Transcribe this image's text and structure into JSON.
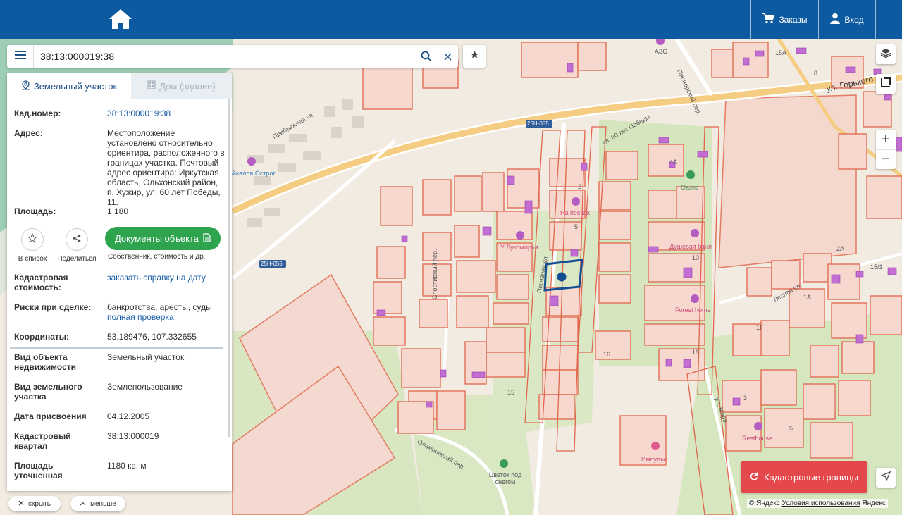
{
  "topbar": {
    "orders_label": "Заказы",
    "login_label": "Вход"
  },
  "search": {
    "value": "38:13:000019:38"
  },
  "tabs": [
    {
      "label": "Земельный участок",
      "active": true
    },
    {
      "label": "Дом (здание)",
      "active": false
    }
  ],
  "info": {
    "cad_number": {
      "label": "Кад.номер:",
      "value": "38:13:000019:38"
    },
    "address": {
      "label": "Адрес:",
      "value": "Местоположение установлено относительно ориентира, расположенного в границах участка. Почтовый адрес ориентира: Иркутская область, Ольхонский район, п. Хужир, ул. 60 лет Победы, 11."
    },
    "area": {
      "label": "Площадь:",
      "value": "1 180"
    },
    "cad_value": {
      "label": "Кадастровая стоимость:",
      "link": "заказать справку на дату"
    },
    "risks": {
      "label": "Риски при сделке:",
      "value": "банкротства, аресты, суды",
      "link": "полная проверка"
    },
    "coords": {
      "label": "Координаты:",
      "value": "53.189476, 107.332655"
    },
    "object_type": {
      "label": "Вид объекта недвижимости",
      "value": "Земельный участок"
    },
    "land_type": {
      "label": "Вид земельного участка",
      "value": "Землепользование"
    },
    "assigned_date": {
      "label": "Дата присвоения",
      "value": "04.12.2005"
    },
    "quarter": {
      "label": "Кадастровый квартал",
      "value": "38:13:000019"
    },
    "refined_area": {
      "label": "Площадь уточненная",
      "value": "1180 кв. м"
    }
  },
  "actions": {
    "favorite_label": "В список",
    "share_label": "Поделиться",
    "docs_label": "Документы объекта",
    "docs_sub": "Собственник, стоимость и др."
  },
  "bottom": {
    "hide_label": "скрыть",
    "less_label": "меньше"
  },
  "map": {
    "cadastral_button": "Кадастровые границы",
    "copyright_prefix": "© Яндекс",
    "copyright_link": "Условия использования",
    "copyright_suffix": "Яндекс",
    "labels": {
      "gorkogo": "ул. Горького",
      "pionerskiy": "Пионерский пер.",
      "pobedy": "ул. 60 лет Победы",
      "pribrezhnaya": "Прибрежная ул.",
      "road1": "25Н-055",
      "road2": "25Н-055",
      "sportivnyy": "Спортивный пер.",
      "peschanaya": "Песчаная ул.",
      "olimpiyskiy": "Олимпийский пер.",
      "mira": "ул. Мира",
      "lesnaya": "Лесная ул.",
      "azs": "АЗС",
      "ostrog": "айкалов Острог",
      "na_peskah": "На песках",
      "lukomorye": "У Лукоморья",
      "dushevaya": "Душевая баня",
      "forest": "Forest home",
      "oasis": "Оазис",
      "resthouse": "Resthouse",
      "impuls": "Импульс",
      "tsvetok": "Цветок под снегом",
      "n15a": "15А",
      "n8": "8",
      "n4a": "4А",
      "n2": "2",
      "n5": "5",
      "n10": "10",
      "n16": "16",
      "n18": "18",
      "n15": "15",
      "n2a": "2А",
      "n15_1": "15/1",
      "n1a": "1А",
      "n1g": "1Г",
      "n3": "3",
      "n5b": "5"
    }
  }
}
